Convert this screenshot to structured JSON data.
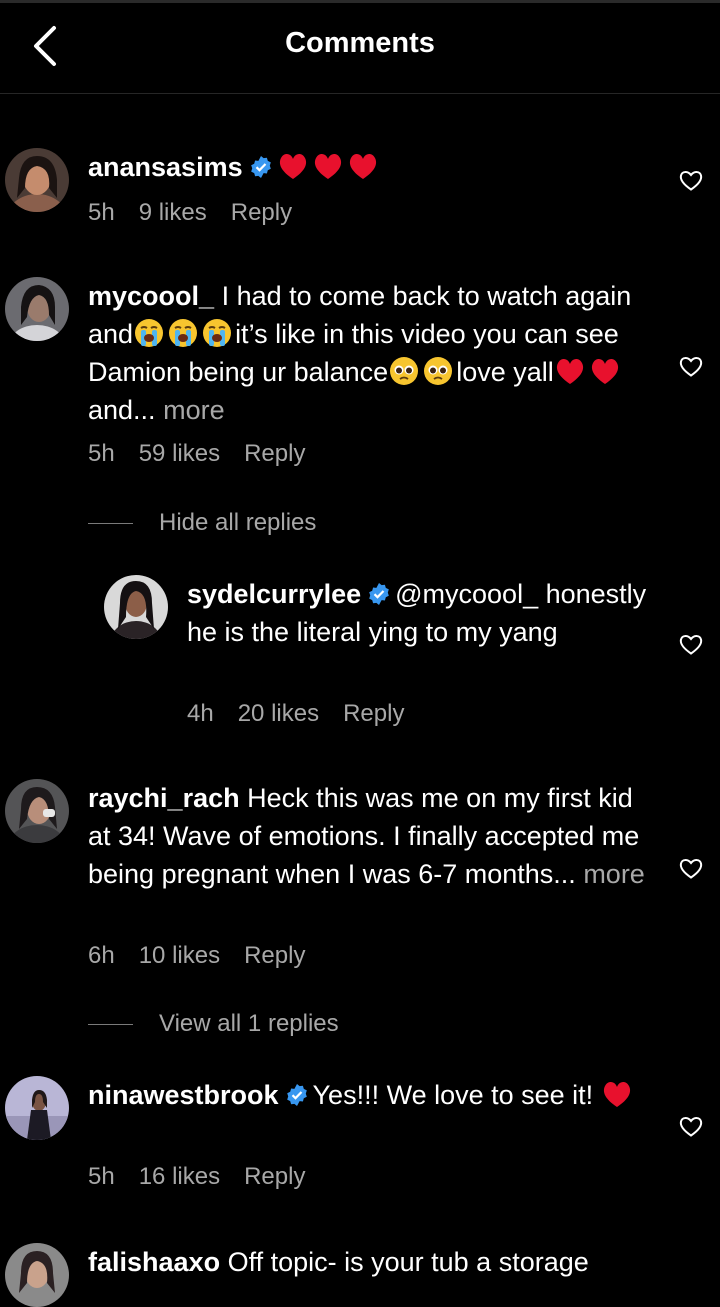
{
  "header": {
    "title": "Comments"
  },
  "comments": [
    {
      "user": "anansasims",
      "verified": true,
      "text": "",
      "time": "5h",
      "likes": "9 likes",
      "reply": "Reply"
    },
    {
      "user": "mycoool_",
      "text_a": "I had to come back to watch again and",
      "text_b": "it’s like in this video you can see Damion being ur balance",
      "text_c": "love yall",
      "text_d": "and...",
      "more": "more",
      "time": "5h",
      "likes": "59 likes",
      "reply": "Reply",
      "toggle": "Hide all replies"
    },
    {
      "user": "sydelcurrylee",
      "verified": true,
      "text": "@mycoool_ honestly he is the literal ying to my yang",
      "time": "4h",
      "likes": "20 likes",
      "reply": "Reply"
    },
    {
      "user": "raychi_rach",
      "text": "Heck this was me on my first kid at 34! Wave of emotions. I finally accepted me being pregnant when I was 6-7 months...",
      "more": "more",
      "time": "6h",
      "likes": "10 likes",
      "reply": "Reply",
      "toggle": "View all 1 replies"
    },
    {
      "user": "ninawestbrook",
      "verified": true,
      "text": "Yes!!! We love to see it!",
      "time": "5h",
      "likes": "16 likes",
      "reply": "Reply"
    },
    {
      "user": "falishaaxo",
      "text": "Off topic- is your tub a storage"
    }
  ],
  "icons": {
    "back": "chevron-left-icon",
    "like": "heart-outline-icon",
    "verified": "verified-badge-icon",
    "heart_emoji": "red-heart-emoji",
    "cry_emoji": "loudly-crying-face-emoji",
    "plead_emoji": "pleading-face-emoji"
  },
  "colors": {
    "background": "#000000",
    "secondary_text": "#a8a8a8",
    "verified": "#3897f0",
    "heart": "#e8112d"
  }
}
